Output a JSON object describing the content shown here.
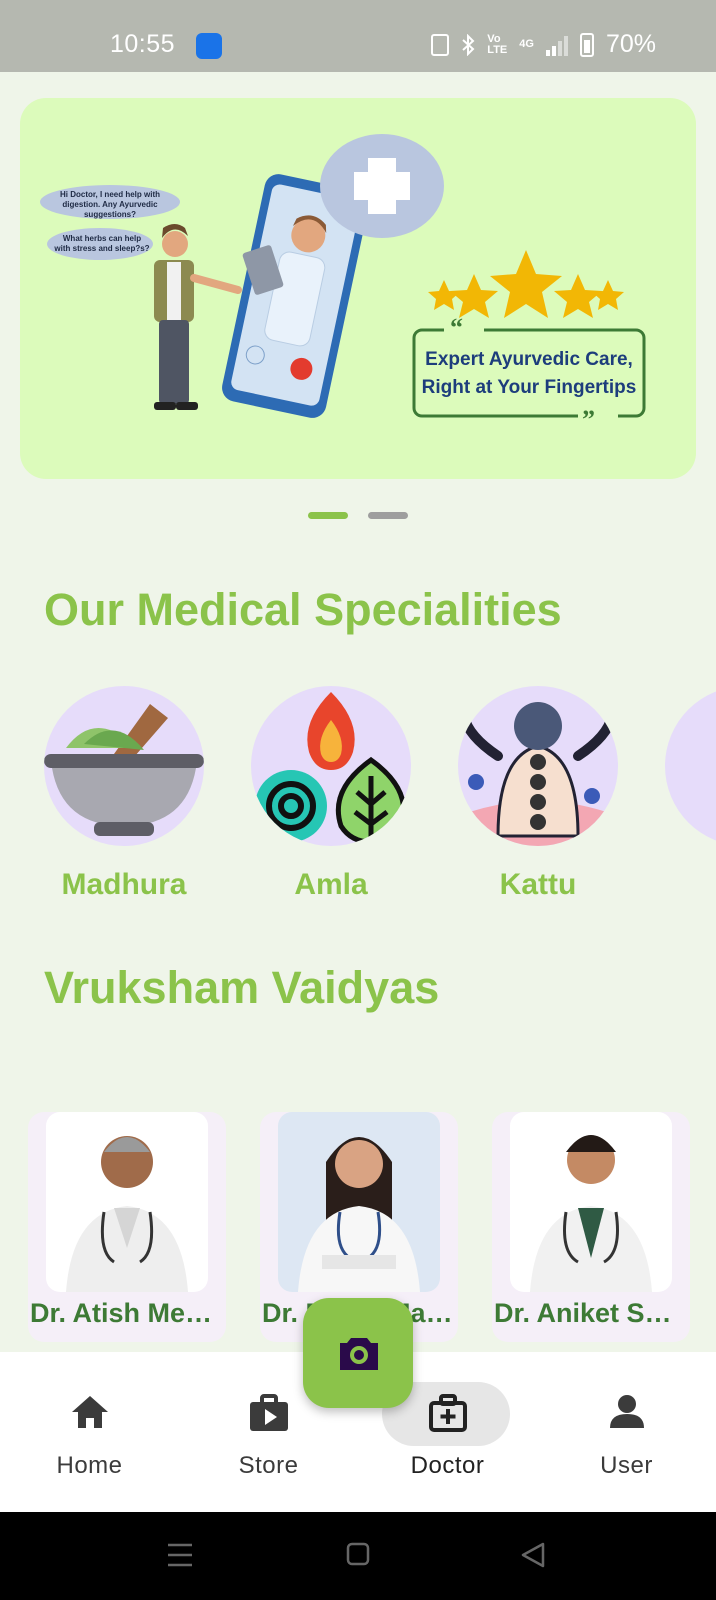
{
  "status_bar": {
    "time": "10:55",
    "battery": "70%",
    "network": "4G",
    "volte_top": "Vo",
    "volte_bottom": "LTE"
  },
  "banner": {
    "bubble1": "Hi Doctor, I need help with digestion. Any Ayurvedic suggestions?",
    "bubble2": "What herbs can help with stress and sleep?s?",
    "tagline_line1": "Expert Ayurvedic Care,",
    "tagline_line2": "Right at Your Fingertips"
  },
  "carousel": {
    "pages": 2,
    "active_index": 0
  },
  "specialities": {
    "title": "Our Medical Specialities",
    "items": [
      {
        "label": "Madhura",
        "icon": "mortar-pestle-icon"
      },
      {
        "label": "Amla",
        "icon": "elements-icon"
      },
      {
        "label": "Kattu",
        "icon": "massage-icon"
      }
    ]
  },
  "vaidyas": {
    "title": "Vruksham Vaidyas",
    "doctors": [
      {
        "name": "Dr. Atish Mehta"
      },
      {
        "name": "Dr. Preeti Malini"
      },
      {
        "name": "Dr. Aniket Sharma"
      }
    ]
  },
  "fab": {
    "icon": "camera-icon"
  },
  "nav": {
    "items": [
      {
        "label": "Home",
        "icon": "home-icon"
      },
      {
        "label": "Store",
        "icon": "store-icon"
      },
      {
        "label": "Doctor",
        "icon": "doctor-kit-icon"
      },
      {
        "label": "User",
        "icon": "user-icon"
      }
    ],
    "active": "Doctor"
  },
  "colors": {
    "accent": "#8bc34a",
    "background": "#eff5e9",
    "banner_bg": "#dcfbbb",
    "doctor_name": "#3d7a35"
  }
}
